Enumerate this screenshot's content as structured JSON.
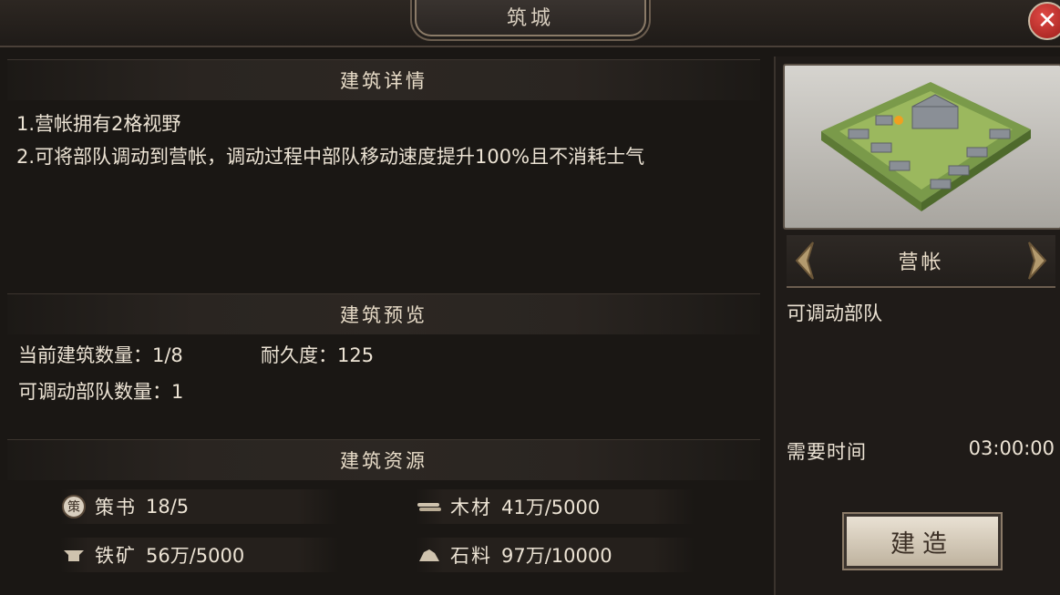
{
  "header": {
    "title": "筑城"
  },
  "details": {
    "heading": "建筑详情",
    "line1": "1.营帐拥有2格视野",
    "line2": "2.可将部队调动到营帐，调动过程中部队移动速度提升100%且不消耗士气"
  },
  "preview": {
    "heading": "建筑预览",
    "count_label": "当前建筑数量：",
    "count_value": "1/8",
    "durability_label": "耐久度：",
    "durability_value": "125",
    "troops_label": "可调动部队数量：",
    "troops_value": "1"
  },
  "resources": {
    "heading": "建筑资源",
    "items": [
      {
        "icon": "strategy-book-icon",
        "name": "策书",
        "value": "18/5"
      },
      {
        "icon": "wood-icon",
        "name": "木材",
        "value": "41万/5000"
      },
      {
        "icon": "iron-ore-icon",
        "name": "铁矿",
        "value": "56万/5000"
      },
      {
        "icon": "stone-icon",
        "name": "石料",
        "value": "97万/10000"
      }
    ]
  },
  "sidebar": {
    "building_name": "营帐",
    "description": "可调动部队",
    "time_label": "需要时间",
    "time_value": "03:00:00",
    "build_label": "建造",
    "badge_text": "策"
  },
  "colors": {
    "accent": "#8b7b68",
    "close": "#c62d28",
    "text": "#ece3d4"
  }
}
